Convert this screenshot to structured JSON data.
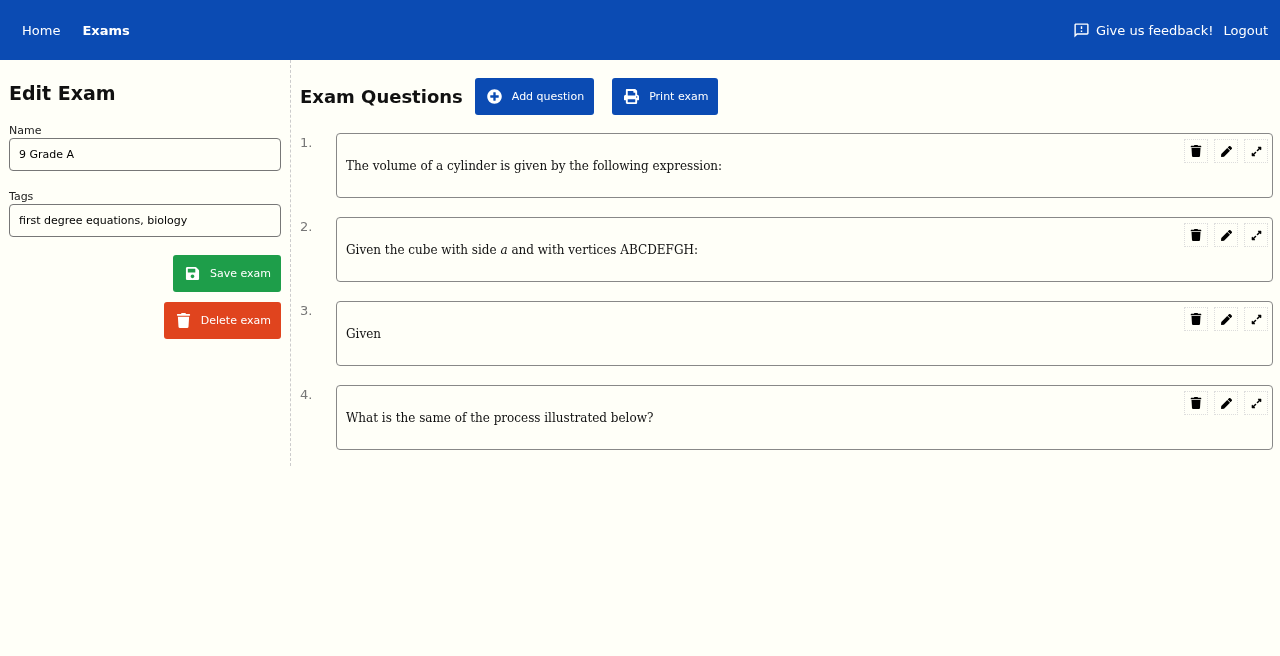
{
  "nav": {
    "links": [
      {
        "label": "Home",
        "selected": false
      },
      {
        "label": "Exams",
        "selected": true
      }
    ],
    "feedback": "Give us feedback!",
    "logout": "Logout"
  },
  "sidebar": {
    "title": "Edit Exam",
    "fields": [
      {
        "label": "Name",
        "value": "9 Grade A"
      },
      {
        "label": "Tags",
        "value": "first degree equations, biology"
      }
    ],
    "buttons": [
      {
        "kind": "save",
        "label": "Save exam"
      },
      {
        "kind": "delete",
        "label": "Delete exam"
      }
    ]
  },
  "main": {
    "title": "Exam Questions",
    "buttons": [
      {
        "kind": "add",
        "label": "Add question"
      },
      {
        "kind": "print",
        "label": "Print exam"
      }
    ],
    "questions": [
      {
        "number": "1.",
        "text": "The volume of a cylinder is given by the following expression:"
      },
      {
        "number": "2.",
        "text": "Given the cube with side *a* and with vertices ABCDEFGH:"
      },
      {
        "number": "3.",
        "text": "Given"
      },
      {
        "number": "4.",
        "text": "What is the same of the process illustrated below?"
      }
    ]
  }
}
